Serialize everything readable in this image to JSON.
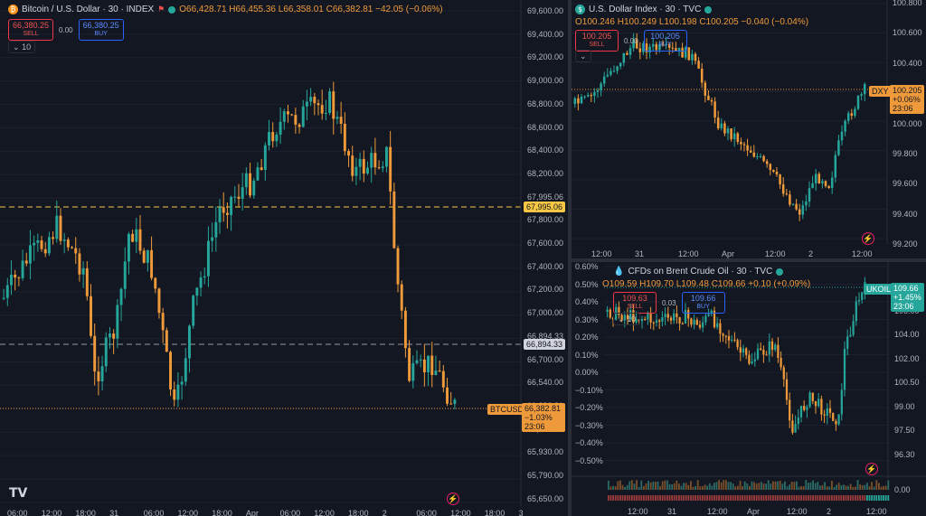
{
  "btc": {
    "legend": {
      "title": "Bitcoin / U.S. Dollar · 30 · INDEX",
      "o": "O66,428.71",
      "h": "H66,455.36",
      "l": "L66,358.01",
      "c": "C66,382.81",
      "chg": "−42.05 (−0.06%)"
    },
    "sell": {
      "price": "66,380.25",
      "label": "SELL"
    },
    "spread": "0.00",
    "buy": {
      "price": "66,380.25",
      "label": "BUY"
    },
    "collapse": "10",
    "y_ticks": [
      "69,600.00",
      "69,400.00",
      "69,200.00",
      "69,000.00",
      "68,800.00",
      "68,600.00",
      "68,400.00",
      "68,200.00",
      "67,995.06",
      "67,800.00",
      "67,600.00",
      "67,400.00",
      "67,200.00",
      "67,000.00",
      "66,894.33",
      "66,700.00",
      "66,540.00",
      "66,382.81",
      "66,070.00",
      "65,930.00",
      "65,790.00",
      "65,650.00"
    ],
    "x_ticks": [
      "06:00",
      "12:00",
      "18:00",
      "31",
      "06:00",
      "12:00",
      "18:00",
      "Apr",
      "06:00",
      "12:00",
      "18:00",
      "2",
      "06:00",
      "12:00",
      "18:00",
      "3"
    ],
    "line_upper": "67,995.06",
    "line_lower": "66,894.33",
    "last": {
      "symbol": "BTCUSD",
      "price": "66,382.81",
      "change": "−1.03%",
      "countdown": "23:06"
    },
    "watermark": "TV",
    "colors": {
      "up": "#26a69a",
      "down": "#ef9a3a",
      "upper_line": "#f7c744",
      "lower_line": "#9598a1"
    }
  },
  "dxy": {
    "legend": {
      "title": "U.S. Dollar Index · 30 · TVC",
      "o": "O100.246",
      "h": "H100.249",
      "l": "L100.198",
      "c": "C100.205",
      "chg": "−0.040 (−0.04%)"
    },
    "sell": {
      "price": "100.205",
      "label": "SELL"
    },
    "buy": {
      "price": "100.205",
      "label": "BUY"
    },
    "spread": "0.00",
    "y_ticks": [
      "100.800",
      "100.600",
      "100.400",
      "100.200",
      "100.000",
      "99.800",
      "99.600",
      "99.400",
      "99.200"
    ],
    "x_ticks": [
      "12:00",
      "31",
      "12:00",
      "Apr",
      "12:00",
      "2",
      "12:00"
    ],
    "last": {
      "symbol": "DXY",
      "price": "100.205",
      "change": "+0.06%",
      "countdown": "23:06"
    }
  },
  "ukoil": {
    "legend": {
      "title": "CFDs on Brent Crude Oil · 30 · TVC",
      "o": "O109.59",
      "h": "H109.70",
      "l": "L109.48",
      "c": "C109.66",
      "chg": "+0.10 (+0.09%)"
    },
    "sell": {
      "price": "109.63",
      "label": "SELL"
    },
    "spread": "0.03",
    "buy": {
      "price": "109.66",
      "label": "BUY"
    },
    "collapse": "10",
    "y_ticks_left": [
      "0.60%",
      "0.50%",
      "0.40%",
      "0.30%",
      "0.20%",
      "0.10%",
      "0.00%",
      "−0.10%",
      "−0.20%",
      "−0.30%",
      "−0.40%",
      "−0.50%"
    ],
    "y_ticks_right": [
      "108.00",
      "106.00",
      "104.00",
      "102.00",
      "100.50",
      "99.00",
      "97.50",
      "96.30"
    ],
    "x_ticks": [
      "12:00",
      "31",
      "12:00",
      "Apr",
      "12:00",
      "2",
      "12:00"
    ],
    "volume_zero": "0.00",
    "last": {
      "symbol": "UKOIL",
      "price": "109.66",
      "change": "+1.45%",
      "countdown": "23:06"
    }
  }
}
